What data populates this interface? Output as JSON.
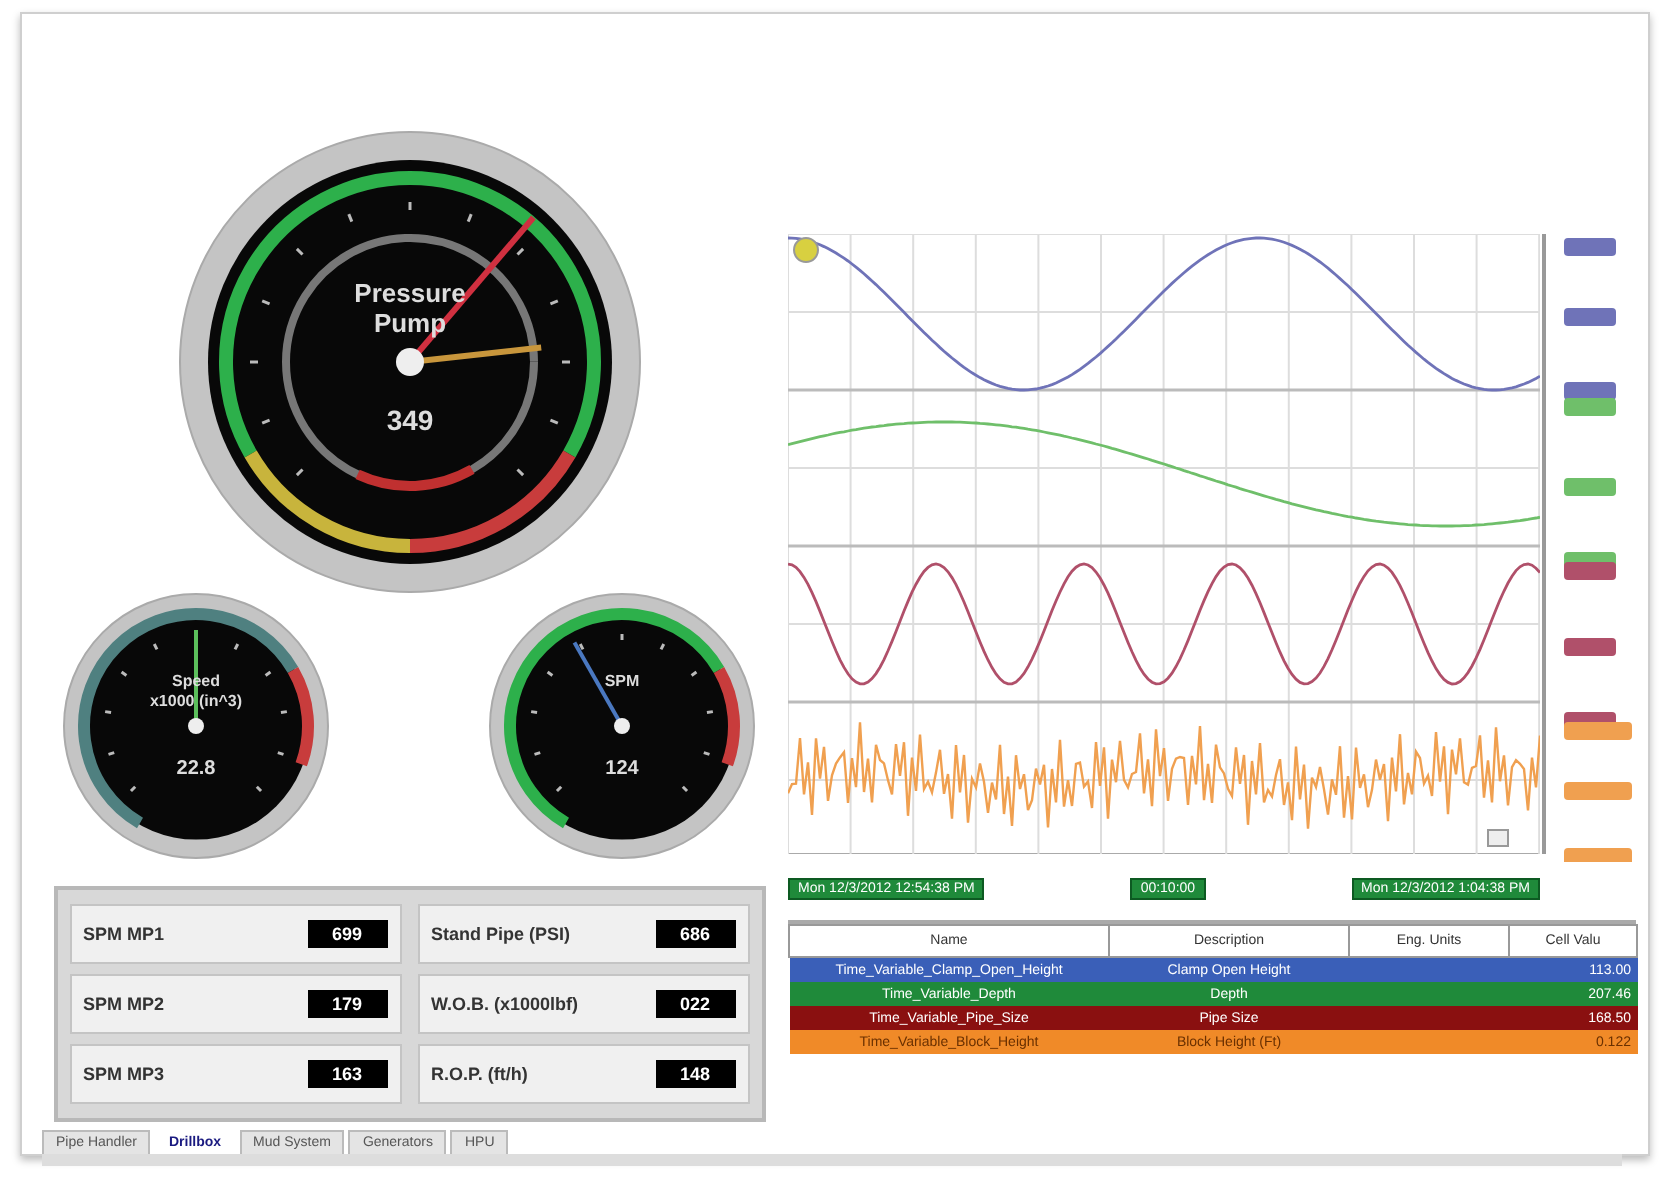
{
  "gauges": [
    {
      "kind": "main",
      "title": [
        "Pressure",
        "Pump"
      ],
      "reading": "349"
    },
    {
      "kind": "speed",
      "title": [
        "Speed",
        "x1000 (in^3)"
      ],
      "reading": "22.8"
    },
    {
      "kind": "spm",
      "title": [
        "SPM"
      ],
      "reading": "124"
    }
  ],
  "readouts": [
    {
      "label": "SPM MP1",
      "value": "699"
    },
    {
      "label": "Stand Pipe (PSI)",
      "value": "686"
    },
    {
      "label": "SPM MP2",
      "value": "179"
    },
    {
      "label": "W.O.B. (x1000lbf)",
      "value": "022"
    },
    {
      "label": "SPM MP3",
      "value": "163"
    },
    {
      "label": "R.O.P. (ft/h)",
      "value": "148"
    }
  ],
  "chart": {
    "traces": [
      {
        "color": "#6f73b8"
      },
      {
        "color": "#6fbf6a"
      },
      {
        "color": "#b0506a"
      },
      {
        "color": "#f0a050"
      }
    ],
    "cursors": [
      "Mon 12/3/2012 12:54:38 PM",
      "00:10:00",
      "Mon 12/3/2012 1:04:38 PM"
    ]
  },
  "table": {
    "columns": [
      "Name",
      "Description",
      "Eng. Units",
      "Cell Valu"
    ],
    "rows": [
      {
        "color": "#3a5fb8",
        "cells": [
          "Time_Variable_Clamp_Open_Height",
          "Clamp Open Height",
          "113.00"
        ]
      },
      {
        "color": "#1f8a3a",
        "cells": [
          "Time_Variable_Depth",
          "Depth",
          "207.46"
        ]
      },
      {
        "color": "#8a1010",
        "cells": [
          "Time_Variable_Pipe_Size",
          "Pipe Size",
          "168.50"
        ]
      },
      {
        "color": "#f08a28",
        "cells": [
          "Time_Variable_Block_Height",
          "Block Height (Ft)",
          "0.122"
        ]
      }
    ]
  },
  "tabs": [
    {
      "label": "Pipe Handler",
      "selected": false
    },
    {
      "label": "Drillbox",
      "selected": true
    },
    {
      "label": "Mud System",
      "selected": false
    },
    {
      "label": "Generators",
      "selected": false
    },
    {
      "label": "HPU",
      "selected": false
    }
  ]
}
